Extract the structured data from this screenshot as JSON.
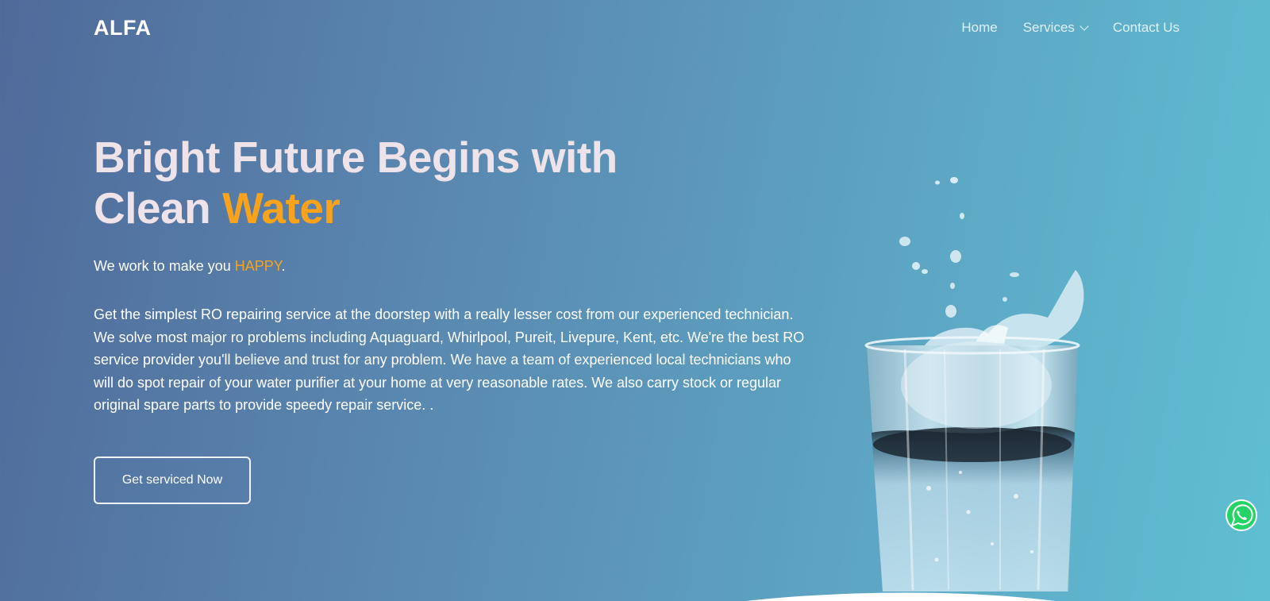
{
  "navbar": {
    "logo": "ALFA",
    "links": [
      {
        "label": "Home"
      },
      {
        "label": "Services"
      },
      {
        "label": "Contact Us"
      }
    ]
  },
  "hero": {
    "title_line1": "Bright Future Begins with",
    "title_line2_prefix": "Clean ",
    "title_line2_accent": "Water",
    "tagline_prefix": "We work to make you ",
    "tagline_accent": "HAPPY",
    "tagline_suffix": ".",
    "description": "Get the simplest RO repairing service at the doorstep with a really lesser cost from our experienced technician. We solve most major ro problems including Aquaguard, Whirlpool, Pureit, Livepure, Kent, etc. We're the best RO service provider you'll believe and trust for any problem. We have a team of experienced local technicians who will do spot repair of your water purifier at your home at very reasonable rates. We also carry stock or regular original spare parts to provide speedy repair service. .",
    "cta_label": "Get serviced Now"
  },
  "icons": {
    "chevron": "chevron-down-icon",
    "whatsapp": "whatsapp-icon",
    "glass": "water-glass-illustration"
  },
  "colors": {
    "accent": "#f8a31b",
    "title": "#efe3ea",
    "whatsapp": "#25d366"
  }
}
